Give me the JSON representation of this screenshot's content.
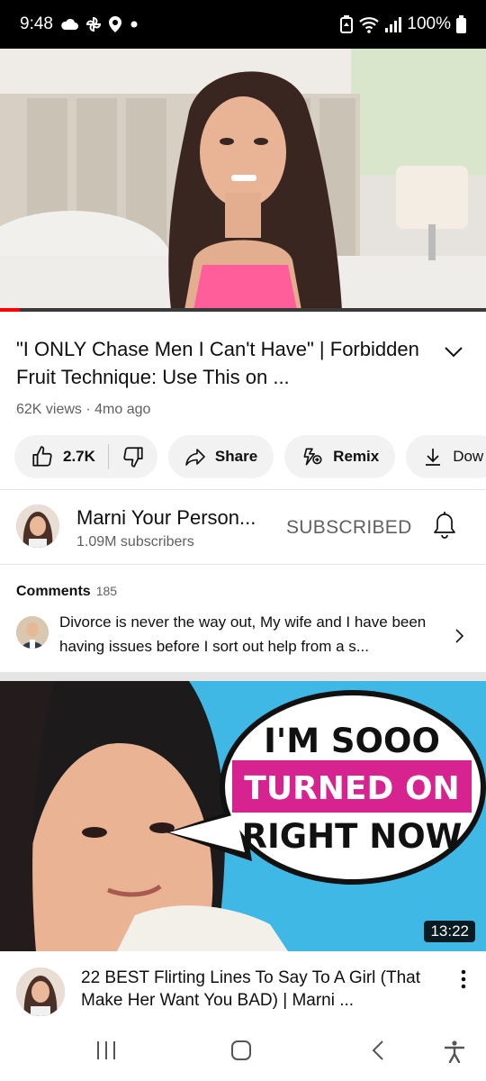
{
  "status_bar": {
    "time": "9:48",
    "battery": "100%",
    "icons": [
      "cloud-icon",
      "pinwheel-icon",
      "location-icon",
      "dot-icon",
      "battery-saver-icon",
      "wifi-icon",
      "signal-icon",
      "battery-icon"
    ]
  },
  "player": {
    "progress": 0.04
  },
  "video": {
    "title": "\"I ONLY Chase Men I Can't Have\" | Forbidden Fruit Technique: Use This on ...",
    "meta": "62K views · 4mo ago"
  },
  "actions": {
    "likes": "2.7K",
    "share": "Share",
    "remix": "Remix",
    "download": "Dow"
  },
  "channel": {
    "name": "Marni Your Person...",
    "subscribers": "1.09M subscribers",
    "subscribed_label": "SUBSCRIBED"
  },
  "comments": {
    "heading": "Comments",
    "count": "185",
    "top_comment": "Divorce is never the way out, My wife and I have been  having issues before I sort out help from a s..."
  },
  "next_video": {
    "thumb_text": [
      "I'M SOOO",
      "TURNED ON",
      "RIGHT NOW"
    ],
    "duration": "13:22",
    "title": "22 BEST Flirting Lines To Say To A Girl (That Make Her Want You BAD) | Marni ..."
  },
  "colors": {
    "accent_red": "#ff0000",
    "thumb_bg": "#3fb8e6",
    "highlight_magenta": "#d6238f"
  }
}
